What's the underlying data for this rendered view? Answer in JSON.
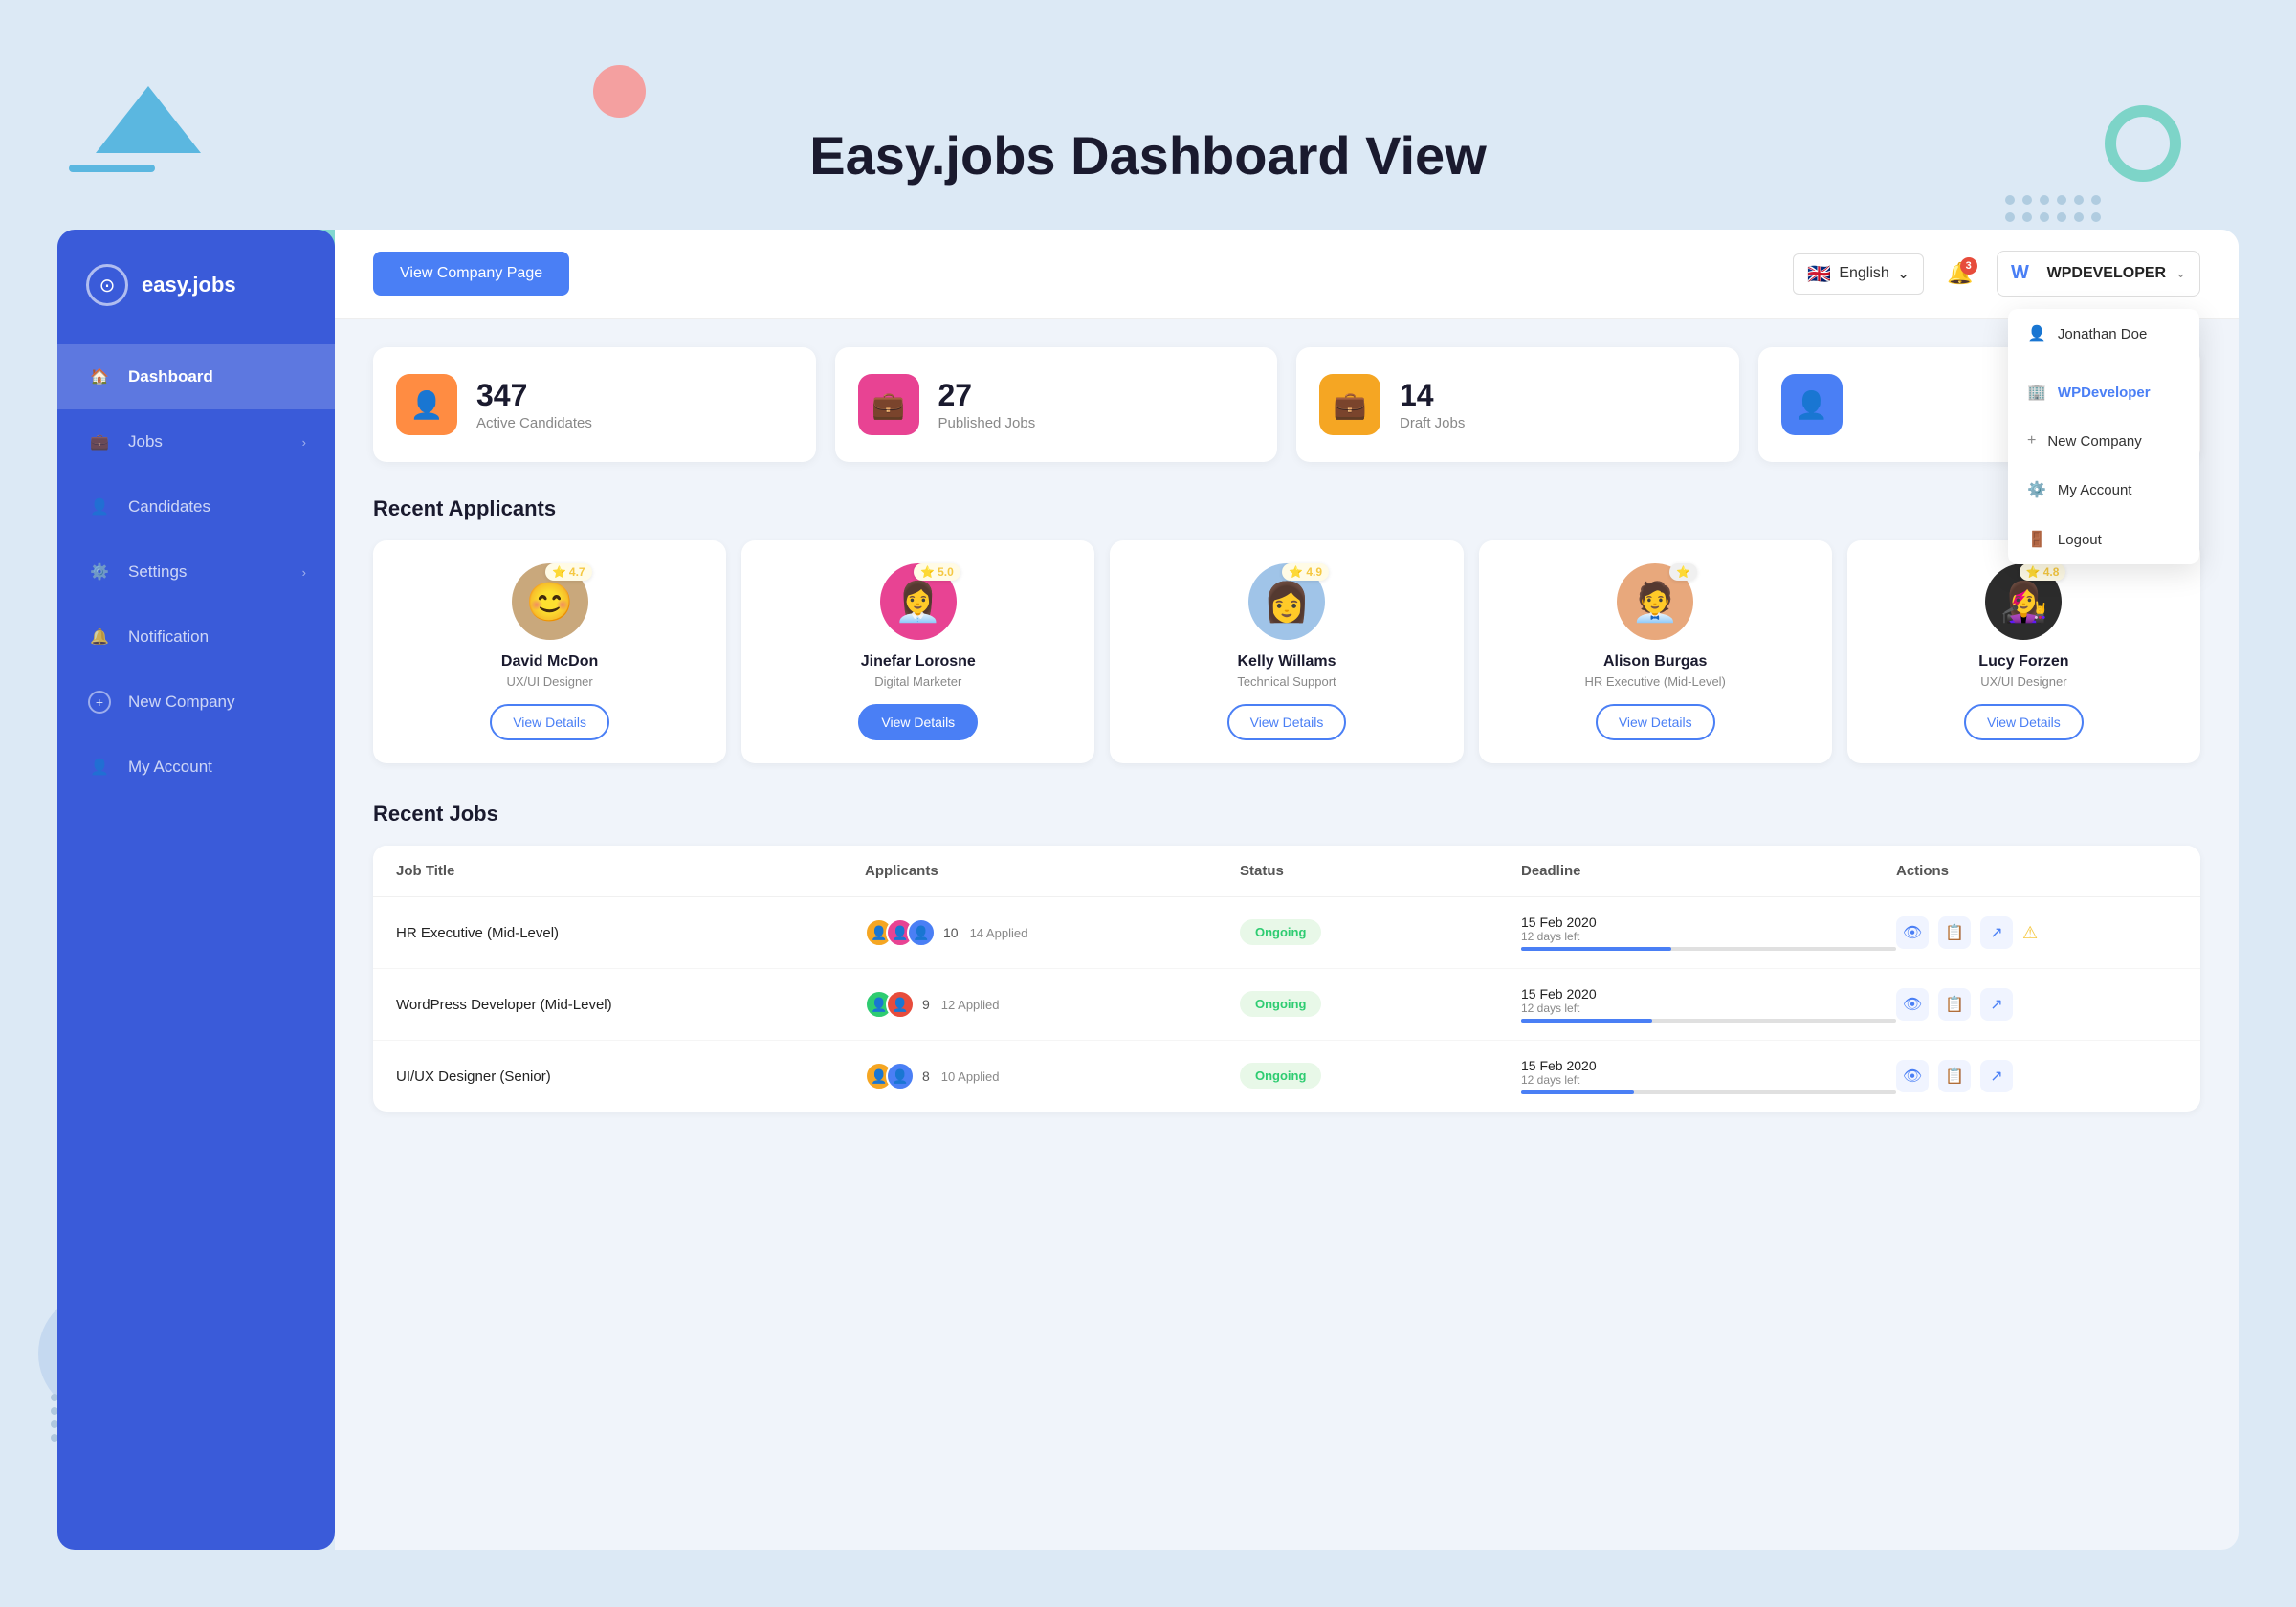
{
  "page": {
    "title": "Easy.jobs Dashboard View",
    "background_color": "#dce9f5"
  },
  "sidebar": {
    "logo_text": "easy.jobs",
    "items": [
      {
        "id": "dashboard",
        "label": "Dashboard",
        "icon": "🏠",
        "active": true,
        "has_arrow": false
      },
      {
        "id": "jobs",
        "label": "Jobs",
        "icon": "💼",
        "active": false,
        "has_arrow": true
      },
      {
        "id": "candidates",
        "label": "Candidates",
        "icon": "👤",
        "active": false,
        "has_arrow": false
      },
      {
        "id": "settings",
        "label": "Settings",
        "icon": "⚙️",
        "active": false,
        "has_arrow": true
      },
      {
        "id": "notification",
        "label": "Notification",
        "icon": "🔔",
        "active": false,
        "has_arrow": false
      },
      {
        "id": "new-company",
        "label": "New Company",
        "icon": "+",
        "active": false,
        "has_arrow": false
      },
      {
        "id": "my-account",
        "label": "My Account",
        "icon": "👤",
        "active": false,
        "has_arrow": false
      }
    ]
  },
  "topbar": {
    "view_company_btn": "View Company Page",
    "language": "English",
    "notification_count": "3",
    "company": {
      "name": "WPDEVELOPER",
      "logo": "WP"
    }
  },
  "dropdown": {
    "items": [
      {
        "id": "jonathan",
        "label": "Jonathan Doe",
        "icon": "👤"
      },
      {
        "id": "wpdeveloper",
        "label": "WPDeveloper",
        "icon": "🏢",
        "active": true
      },
      {
        "id": "new-company",
        "label": "New Company",
        "icon": "+"
      },
      {
        "id": "my-account",
        "label": "My Account",
        "icon": "⚙️"
      },
      {
        "id": "logout",
        "label": "Logout",
        "icon": "🚪"
      }
    ]
  },
  "stats": [
    {
      "id": "active-candidates",
      "number": "347",
      "label": "Active Candidates",
      "icon": "👤",
      "color_class": "stat-icon-orange"
    },
    {
      "id": "published-jobs",
      "number": "27",
      "label": "Published Jobs",
      "icon": "💼",
      "color_class": "stat-icon-pink"
    },
    {
      "id": "draft-jobs",
      "number": "14",
      "label": "Draft Jobs",
      "icon": "💼",
      "color_class": "stat-icon-amber"
    },
    {
      "id": "extra",
      "number": "",
      "label": "",
      "icon": "👤",
      "color_class": "stat-icon-blue"
    }
  ],
  "recent_applicants": {
    "title": "Recent Applicants",
    "items": [
      {
        "id": "david",
        "name": "David McDon",
        "role": "UX/UI Designer",
        "rating": "4.7",
        "avatar_emoji": "😊",
        "active": false
      },
      {
        "id": "jinefar",
        "name": "Jinefar Lorosne",
        "role": "Digital Marketer",
        "rating": "5.0",
        "avatar_emoji": "👩‍💼",
        "active": true
      },
      {
        "id": "kelly",
        "name": "Kelly Willams",
        "role": "Technical Support",
        "rating": "4.9",
        "avatar_emoji": "👩",
        "active": false
      },
      {
        "id": "alison",
        "name": "Alison Burgas",
        "role": "HR Executive (Mid-Level)",
        "rating": "",
        "avatar_emoji": "🧑‍💼",
        "active": false
      },
      {
        "id": "lucy",
        "name": "Lucy Forzen",
        "role": "UX/UI Designer",
        "rating": "4.8",
        "avatar_emoji": "👩‍🎤",
        "active": false
      }
    ],
    "view_details_label": "View Details"
  },
  "recent_jobs": {
    "title": "Recent Jobs",
    "columns": [
      "Job Title",
      "Applicants",
      "Status",
      "Deadline",
      "Actions"
    ],
    "rows": [
      {
        "id": "hr-executive",
        "title": "HR Executive (Mid-Level)",
        "applicant_count": 10,
        "applied": "14 Applied",
        "status": "Ongoing",
        "deadline_date": "15 Feb 2020",
        "deadline_left": "12 days left",
        "progress": 40
      },
      {
        "id": "wordpress-developer",
        "title": "WordPress Developer (Mid-Level)",
        "applicant_count": 9,
        "applied": "12 Applied",
        "status": "Ongoing",
        "deadline_date": "15 Feb 2020",
        "deadline_left": "12 days left",
        "progress": 35
      },
      {
        "id": "third-job",
        "title": "UI/UX Designer (Senior)",
        "applicant_count": 8,
        "applied": "10 Applied",
        "status": "Ongoing",
        "deadline_date": "15 Feb 2020",
        "deadline_left": "12 days left",
        "progress": 30
      }
    ]
  }
}
